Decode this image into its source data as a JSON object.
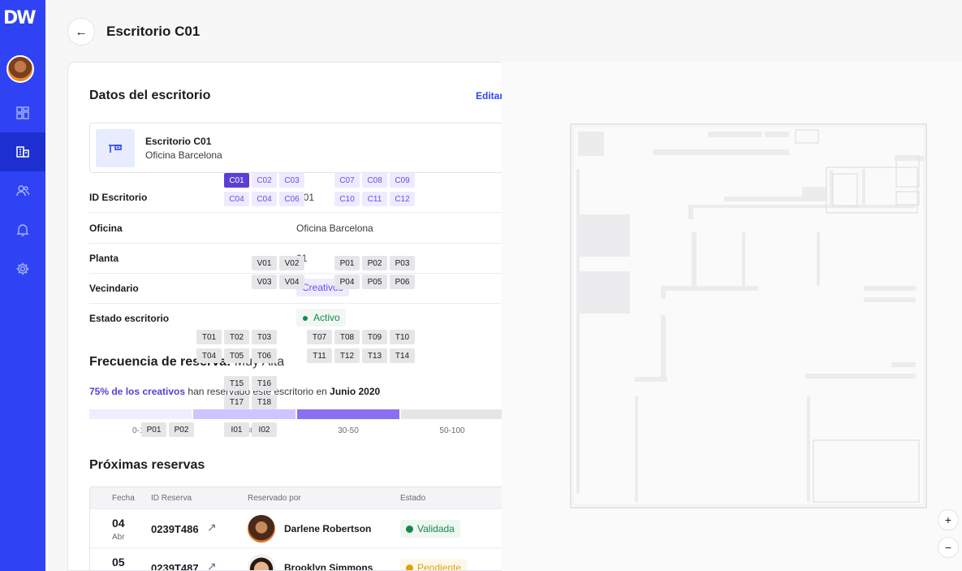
{
  "app": {
    "logo": "DW"
  },
  "sidebar": {
    "items": [
      {
        "name": "dashboard",
        "icon": "grid-icon"
      },
      {
        "name": "offices",
        "icon": "building-icon",
        "active": true
      },
      {
        "name": "users",
        "icon": "users-icon"
      },
      {
        "name": "notifications",
        "icon": "bell-icon"
      },
      {
        "name": "settings",
        "icon": "gear-icon"
      }
    ]
  },
  "header": {
    "title": "Escritorio C01",
    "back_icon": "←"
  },
  "details": {
    "title": "Datos del escritorio",
    "edit_label": "Editar",
    "desk_name": "Escritorio C01",
    "desk_office": "Oficina Barcelona",
    "rows": [
      {
        "label": "ID Escritorio",
        "value": "C01"
      },
      {
        "label": "Oficina",
        "value": "Oficina Barcelona"
      },
      {
        "label": "Planta",
        "value": "01"
      },
      {
        "label": "Vecindario",
        "value": "Creativos"
      },
      {
        "label": "Estado escritorio",
        "value": "Activo"
      }
    ]
  },
  "frequency": {
    "title": "Frecuencia de reserva:",
    "value": "Muy Alta",
    "highlight": "75% de los creativos",
    "sentence": " han reservado este escritorio en ",
    "month": "Junio 2020",
    "level_percent": 75,
    "segments": [
      {
        "label": "0-10",
        "color": "#f0edff"
      },
      {
        "label": "10-30",
        "color": "#cfc4ff"
      },
      {
        "label": "30-50",
        "color": "#8b6ff2"
      },
      {
        "label": "50-100",
        "color": "#5b3fd4"
      }
    ],
    "empty_color": "#e6e6e8"
  },
  "upcoming": {
    "title": "Próximas reservas",
    "columns": [
      "Fecha",
      "ID Reserva",
      "Reservado por",
      "Estado"
    ],
    "rows": [
      {
        "day": "04",
        "month": "Abr",
        "id": "0239T486",
        "person": "Darlene Robertson",
        "status": "Validada",
        "status_color": "#138a4a",
        "status_bg": "#eef7f1"
      },
      {
        "day": "05",
        "month": "",
        "id": "0239T487",
        "person": "Brooklyn Simmons",
        "status": "Pendiente",
        "status_color": "#e0a012",
        "status_bg": "#fff8e8"
      }
    ],
    "link_icon": "↗"
  },
  "map": {
    "creative_desks": [
      "C01",
      "C02",
      "C03",
      "C04",
      "C04",
      "C06",
      "C07",
      "C08",
      "C09",
      "C10",
      "C11",
      "C12"
    ],
    "selected_desk": "C01",
    "other_desks": [
      "V01",
      "V02",
      "V03",
      "V04",
      "P01",
      "P02",
      "P03",
      "P04",
      "P05",
      "P06",
      "T01",
      "T02",
      "T03",
      "T04",
      "T05",
      "T06",
      "T07",
      "T08",
      "T09",
      "T10",
      "T11",
      "T12",
      "T13",
      "T14",
      "T15",
      "T16",
      "T17",
      "T18",
      "P01",
      "P02",
      "I01",
      "I02"
    ],
    "zoom_in": "+",
    "zoom_out": "−"
  }
}
